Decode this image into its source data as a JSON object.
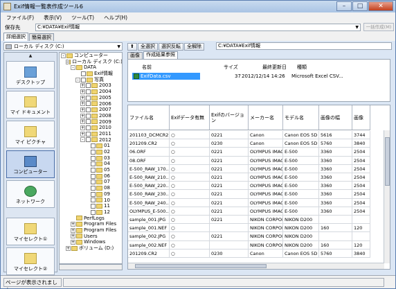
{
  "window": {
    "title": "Exif情報一覧表作成ツール6"
  },
  "menu": [
    "ファイル(F)",
    "表示(V)",
    "ツール(T)",
    "ヘルプ(H)"
  ],
  "path": {
    "label": "保存先",
    "value": "C:¥DATA¥Exif情報",
    "button": "一括作成(M)"
  },
  "mode_tabs": [
    "詳細選択",
    "簡易選択"
  ],
  "drive": "ローカル ディスク (C:)",
  "places": [
    "デスクトップ",
    "マイ ドキュメント",
    "マイ ピクチャ",
    "コンピューター",
    "ネットワーク",
    "マイセレクト①",
    "マイセレクト②"
  ],
  "tree": [
    {
      "t": "コンピューター",
      "d": 0,
      "ex": "-"
    },
    {
      "t": "ローカル ディスク (C:)",
      "d": 1,
      "ex": "-"
    },
    {
      "t": "DATA",
      "d": 2,
      "ex": "-"
    },
    {
      "t": "Exif情報",
      "d": 3,
      "ex": ""
    },
    {
      "t": "写真",
      "d": 3,
      "ex": "-"
    },
    {
      "t": "2003",
      "d": 4,
      "ex": "+"
    },
    {
      "t": "2004",
      "d": 4,
      "ex": "+"
    },
    {
      "t": "2005",
      "d": 4,
      "ex": "+"
    },
    {
      "t": "2006",
      "d": 4,
      "ex": "+"
    },
    {
      "t": "2007",
      "d": 4,
      "ex": "+"
    },
    {
      "t": "2008",
      "d": 4,
      "ex": "+"
    },
    {
      "t": "2009",
      "d": 4,
      "ex": "+"
    },
    {
      "t": "2010",
      "d": 4,
      "ex": "+"
    },
    {
      "t": "2011",
      "d": 4,
      "ex": "+"
    },
    {
      "t": "2012",
      "d": 4,
      "ex": "-"
    },
    {
      "t": "01",
      "d": 5,
      "ex": ""
    },
    {
      "t": "02",
      "d": 5,
      "ex": ""
    },
    {
      "t": "03",
      "d": 5,
      "ex": ""
    },
    {
      "t": "04",
      "d": 5,
      "ex": ""
    },
    {
      "t": "05",
      "d": 5,
      "ex": ""
    },
    {
      "t": "06",
      "d": 5,
      "ex": ""
    },
    {
      "t": "07",
      "d": 5,
      "ex": ""
    },
    {
      "t": "08",
      "d": 5,
      "ex": ""
    },
    {
      "t": "09",
      "d": 5,
      "ex": ""
    },
    {
      "t": "10",
      "d": 5,
      "ex": ""
    },
    {
      "t": "11",
      "d": 5,
      "ex": ""
    },
    {
      "t": "12",
      "d": 5,
      "ex": ""
    },
    {
      "t": "PerfLogs",
      "d": 2,
      "ex": ""
    },
    {
      "t": "Program Files",
      "d": 2,
      "ex": "+"
    },
    {
      "t": "Program Files",
      "d": 2,
      "ex": "+"
    },
    {
      "t": "Users",
      "d": 2,
      "ex": "+"
    },
    {
      "t": "Windows",
      "d": 2,
      "ex": "+"
    },
    {
      "t": "ボリューム (D:)",
      "d": 1,
      "ex": "+"
    }
  ],
  "toolbar": [
    "全選択",
    "選択反転",
    "全解除"
  ],
  "current_path": "C:¥DATA¥Exif情報",
  "right_tabs": [
    "画像",
    "作成結果参照"
  ],
  "output": {
    "headers": [
      "名前",
      "サイズ",
      "最終更新日",
      "種類"
    ],
    "row": {
      "name": "ExifData.csv",
      "size": "37",
      "date": "2012/12/14 14:26",
      "type": "Microsoft Excel CSV..."
    }
  },
  "grid": {
    "headers": [
      "ファイル名",
      "Exifデータ有無",
      "Exifのバージョン",
      "メーカー名",
      "モデル名",
      "画像の幅",
      "画像"
    ],
    "rows": [
      [
        "201103_DCMCR2",
        "○",
        "0221",
        "Canon",
        "Canon EOS 5D ...",
        "5616",
        "3744"
      ],
      [
        "201209.CR2",
        "○",
        "0230",
        "Canon",
        "Canon EOS 5D ...",
        "5760",
        "3840"
      ],
      [
        "06.ORF",
        "○",
        "0221",
        "OLYMPUS IMAGI...",
        "E-500",
        "3360",
        "2504"
      ],
      [
        "08.ORF",
        "○",
        "0221",
        "OLYMPUS IMAGI...",
        "E-500",
        "3360",
        "2504"
      ],
      [
        "E-500_RAW_170...",
        "○",
        "0221",
        "OLYMPUS IMAGI...",
        "E-500",
        "3360",
        "2504"
      ],
      [
        "E-500_RAW_210...",
        "○",
        "0221",
        "OLYMPUS IMAGI...",
        "E-500",
        "3360",
        "2504"
      ],
      [
        "E-500_RAW_220...",
        "○",
        "0221",
        "OLYMPUS IMAGI...",
        "E-500",
        "3360",
        "2504"
      ],
      [
        "E-500_RAW_230...",
        "○",
        "0221",
        "OLYMPUS IMAGI...",
        "E-500",
        "3360",
        "2504"
      ],
      [
        "E-500_RAW_240...",
        "○",
        "0221",
        "OLYMPUS IMAGI...",
        "E-500",
        "3360",
        "2504"
      ],
      [
        "OLYMPUS_E-500...",
        "○",
        "0221",
        "OLYMPUS IMAGI...",
        "E-500",
        "3360",
        "2504"
      ],
      [
        "sample_001.JPG",
        "○",
        "0221",
        "NIKON CORPOR...",
        "NIKON D200",
        "",
        ""
      ],
      [
        "sample_001.NEF",
        "○",
        "",
        "NIKON CORPOR...",
        "NIKON D200",
        "160",
        "120"
      ],
      [
        "sample_002.JPG",
        "○",
        "0221",
        "NIKON CORPOR...",
        "NIKON D200",
        "",
        ""
      ],
      [
        "sample_002.NEF",
        "○",
        "",
        "NIKON CORPOR...",
        "NIKON D200",
        "160",
        "120"
      ],
      [
        "201209.CR2",
        "○",
        "0230",
        "Canon",
        "Canon EOS 5D ...",
        "5760",
        "3840"
      ]
    ]
  },
  "status": "ページが表示されました"
}
